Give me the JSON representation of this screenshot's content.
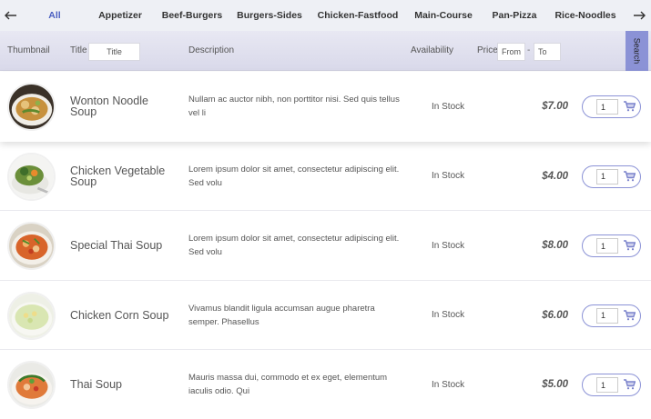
{
  "tabs": {
    "prev_icon": "arrow-left-icon",
    "next_icon": "arrow-right-icon",
    "items": [
      {
        "label": "All",
        "active": true
      },
      {
        "label": "Appetizer"
      },
      {
        "label": "Beef-Burgers"
      },
      {
        "label": "Burgers-Sides"
      },
      {
        "label": "Chicken-Fastfood"
      },
      {
        "label": "Main-Course"
      },
      {
        "label": "Pan-Pizza"
      },
      {
        "label": "Rice-Noodles"
      }
    ]
  },
  "filters": {
    "thumbnail_label": "Thumbnail",
    "title_label": "Title",
    "title_placeholder": "Title",
    "description_label": "Description",
    "availability_label": "Availability",
    "price_label": "Price",
    "price_from_placeholder": "From",
    "price_separator": "-",
    "price_to_placeholder": "To",
    "search_label": "Search"
  },
  "products": [
    {
      "title": "Wonton Noodle Soup",
      "description": "Nullam ac auctor nibh, non porttitor nisi. Sed quis tellus vel li",
      "availability": "In Stock",
      "price": "$7.00",
      "qty": "1"
    },
    {
      "title": "Chicken Vegetable Soup",
      "description": "Lorem ipsum dolor sit amet, consectetur adipiscing elit. Sed volu",
      "availability": "In Stock",
      "price": "$4.00",
      "qty": "1"
    },
    {
      "title": "Special Thai Soup",
      "description": "Lorem ipsum dolor sit amet, consectetur adipiscing elit. Sed volu",
      "availability": "In Stock",
      "price": "$8.00",
      "qty": "1"
    },
    {
      "title": "Chicken Corn Soup",
      "description": "Vivamus blandit ligula accumsan augue pharetra semper. Phasellus",
      "availability": "In Stock",
      "price": "$6.00",
      "qty": "1"
    },
    {
      "title": "Thai Soup",
      "description": "Mauris massa dui, commodo et ex eget, elementum iaculis odio. Qui",
      "availability": "In Stock",
      "price": "$5.00",
      "qty": "1"
    }
  ],
  "colors": {
    "accent": "#4a5fc1",
    "search_button": "#8b92d6",
    "header_bg": "#eef0f5"
  }
}
